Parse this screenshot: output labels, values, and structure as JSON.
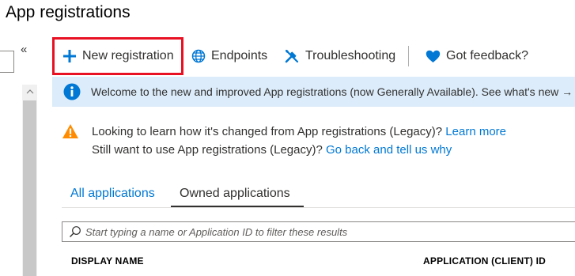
{
  "header": {
    "title": "App registrations"
  },
  "left_panel": {
    "collapse_label": "«"
  },
  "toolbar": {
    "new_registration": "New registration",
    "endpoints": "Endpoints",
    "troubleshooting": "Troubleshooting",
    "feedback": "Got feedback?"
  },
  "info_banner": {
    "text": "Welcome to the new and improved App registrations (now Generally Available). See what's new",
    "arrow": "→"
  },
  "warning": {
    "line1_text": "Looking to learn how it's changed from App registrations (Legacy)?",
    "line1_link": "Learn more",
    "line2_text": "Still want to use App registrations (Legacy)?",
    "line2_link": "Go back and tell us why"
  },
  "tabs": [
    {
      "label": "All applications",
      "selected": false
    },
    {
      "label": "Owned applications",
      "selected": true
    }
  ],
  "search": {
    "placeholder": "Start typing a name or Application ID to filter these results",
    "value": ""
  },
  "table": {
    "columns": [
      "DISPLAY NAME",
      "APPLICATION (CLIENT) ID"
    ]
  },
  "colors": {
    "accent": "#0078d4",
    "highlight_border": "#e81123",
    "info_background": "#dcecfa",
    "warning": "#ff8c00"
  },
  "icons": {
    "new_registration": "plus-icon",
    "endpoints": "globe-icon",
    "troubleshooting": "tools-icon",
    "feedback": "heart-icon",
    "info": "info-icon",
    "warning": "warning-icon",
    "search": "search-icon"
  }
}
